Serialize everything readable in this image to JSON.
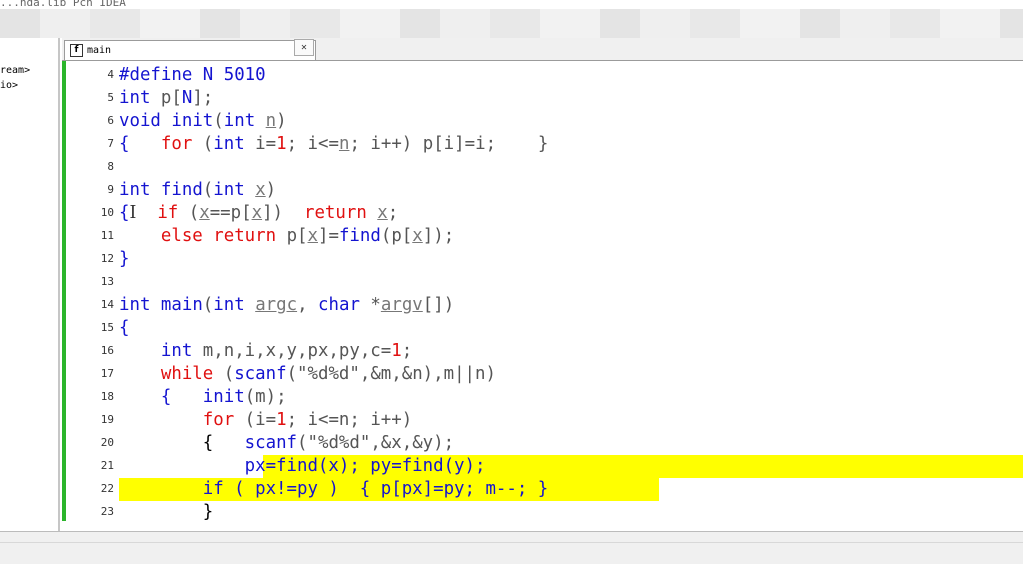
{
  "window": {
    "title": "  ...nda.lib Pch IDEA"
  },
  "left_panel": {
    "items": [
      "ream>",
      "io>"
    ]
  },
  "editor_tabs": [
    {
      "label": "main",
      "icon": "file-icon"
    }
  ],
  "colors": {
    "keyword": "#1414d0",
    "red": "#e01010",
    "highlight": "#ffff00",
    "gutter": "#2bb52b"
  },
  "editor": {
    "lines": [
      {
        "n": "4",
        "code": "#define N 5010"
      },
      {
        "n": "5",
        "code": "int p[N];"
      },
      {
        "n": "6",
        "code": "void init(int n)"
      },
      {
        "n": "7",
        "code": "{    for (int i=1; i<=n; i++) p[i]=i;    }"
      },
      {
        "n": "8",
        "code": ""
      },
      {
        "n": "9",
        "code": "int find(int x)"
      },
      {
        "n": "10",
        "code": "{I  if (x==p[x])  return x;"
      },
      {
        "n": "11",
        "code": "    else return p[x]=find(p[x]);"
      },
      {
        "n": "12",
        "code": "}"
      },
      {
        "n": "13",
        "code": ""
      },
      {
        "n": "14",
        "code": "int main(int argc, char *argv[])"
      },
      {
        "n": "15",
        "code": "{"
      },
      {
        "n": "16",
        "code": "    int m,n,i,x,y,px,py,c=1;"
      },
      {
        "n": "17",
        "code": "    while (scanf(\"%d%d\",&m,&n),m||n)"
      },
      {
        "n": "18",
        "code": "    {   init(m);"
      },
      {
        "n": "19",
        "code": "        for (i=1; i<=n; i++)"
      },
      {
        "n": "20",
        "code": "        {   scanf(\"%d%d\",&x,&y);"
      },
      {
        "n": "21",
        "code": "            px=find(x); py=find(y);"
      },
      {
        "n": "22",
        "code": "        if ( px!=py )  { p[px]=py; m--; }"
      },
      {
        "n": "23",
        "code": "        }"
      }
    ]
  }
}
